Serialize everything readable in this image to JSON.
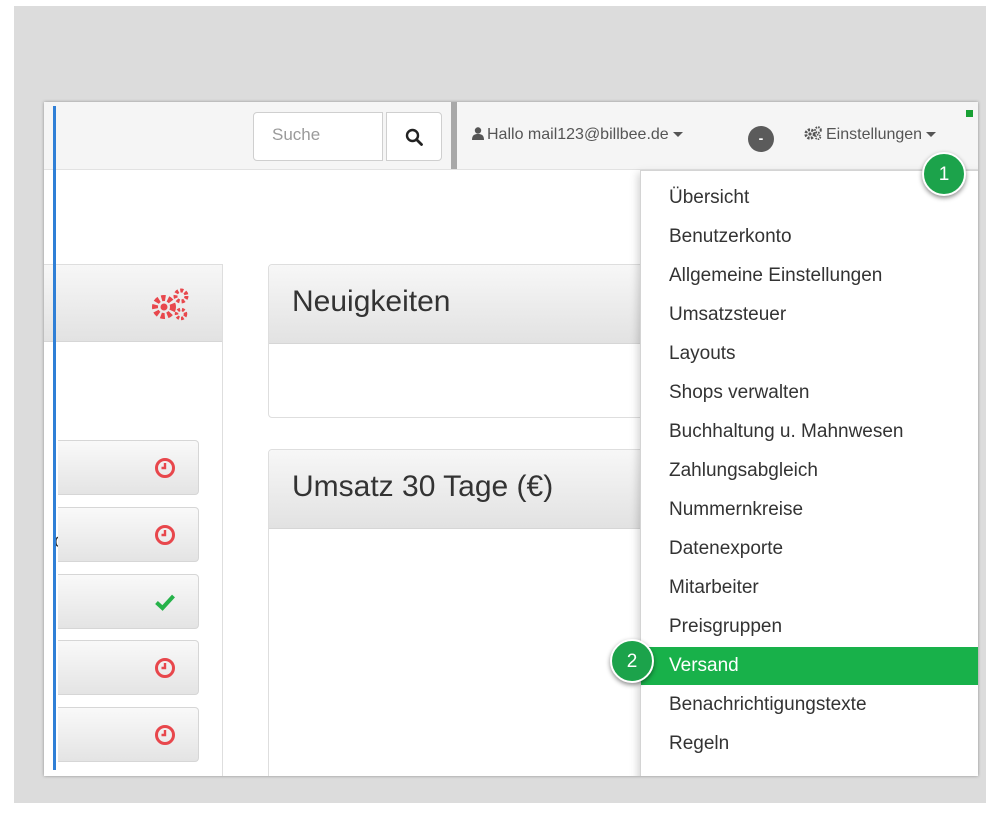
{
  "header": {
    "search_placeholder": "Suche",
    "user_greeting": "Hallo mail123@billbee.de",
    "minus_badge": "-",
    "settings_label": "Einstellungen"
  },
  "panels": {
    "news_title": "Neuigkeiten",
    "revenue_title": "Umsatz 30 Tage (€)",
    "account_partial": "count"
  },
  "status_buttons": [
    {
      "icon": "clock-icon",
      "color": "#e8474c"
    },
    {
      "icon": "clock-icon",
      "color": "#e8474c"
    },
    {
      "icon": "check-icon",
      "color": "#26b24a"
    },
    {
      "icon": "clock-icon",
      "color": "#e8474c"
    },
    {
      "icon": "clock-icon",
      "color": "#e8474c"
    }
  ],
  "settings_menu": {
    "items": [
      "Übersicht",
      "Benutzerkonto",
      "Allgemeine Einstellungen",
      "Umsatzsteuer",
      "Layouts",
      "Shops verwalten",
      "Buchhaltung u. Mahnwesen",
      "Zahlungsabgleich",
      "Nummernkreise",
      "Datenexporte",
      "Mitarbeiter",
      "Preisgruppen",
      "Versand",
      "Benachrichtigungstexte",
      "Regeln"
    ],
    "active_item": "Versand"
  },
  "step_badges": [
    "1",
    "2"
  ],
  "colors": {
    "accent_green": "#18b14a",
    "status_red": "#e8474c",
    "status_green": "#26b24a",
    "left_border_blue": "#2f7fd6"
  }
}
